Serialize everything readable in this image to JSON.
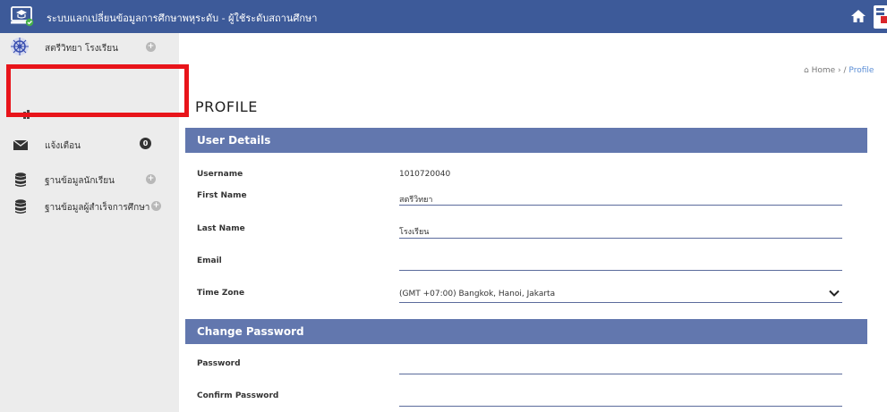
{
  "app": {
    "title": "ระบบแลกเปลี่ยนข้อมูลการศึกษาพหุระดับ - ผู้ใช้ระดับสถานศึกษา",
    "accent_color": "#3d5a99",
    "header_color": "#6277ae"
  },
  "sidebar": {
    "user_name": "สตรีวิทยา โรงเรียน",
    "items": [
      {
        "label": "แจ้งเตือน",
        "icon": "envelope-icon",
        "badge": "0"
      },
      {
        "label": "ฐานข้อมูลนักเรียน",
        "icon": "database-icon"
      },
      {
        "label": "ฐานข้อมูลผู้สำเร็จการศึกษา",
        "icon": "database-icon"
      }
    ]
  },
  "breadcrumb": {
    "home": "Home",
    "separator": " / ",
    "current": "Profile"
  },
  "page": {
    "title": "PROFILE",
    "user_details": {
      "header": "User Details",
      "username_label": "Username",
      "username_value": "1010720040",
      "first_name_label": "First Name",
      "first_name_value": "สตรีวิทยา",
      "last_name_label": "Last Name",
      "last_name_value": "โรงเรียน",
      "email_label": "Email",
      "email_value": "",
      "timezone_label": "Time Zone",
      "timezone_value": "(GMT +07:00) Bangkok, Hanoi, Jakarta"
    },
    "change_password": {
      "header": "Change Password",
      "password_label": "Password",
      "confirm_label": "Confirm Password"
    }
  }
}
